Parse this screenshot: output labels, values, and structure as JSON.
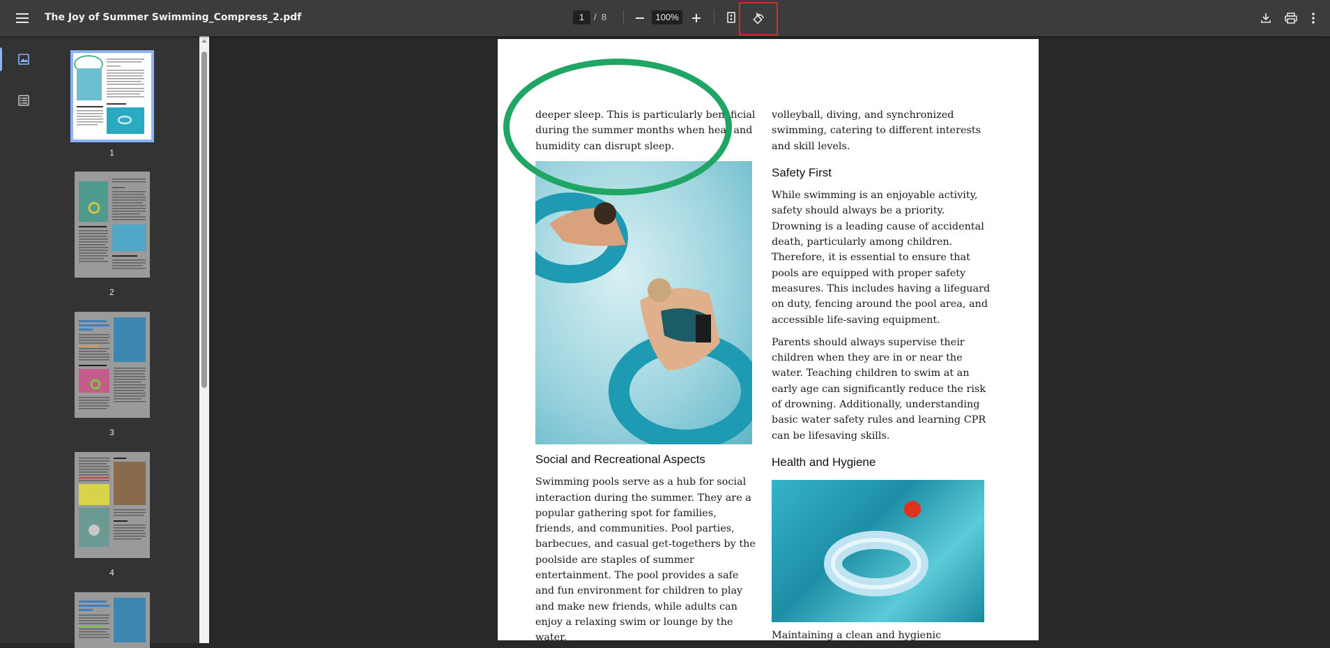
{
  "toolbar": {
    "title": "The Joy of Summer Swimming_Compress_2.pdf",
    "current_page": "1",
    "page_separator": "/",
    "total_pages": "8",
    "zoom": "100%"
  },
  "sidebar": {
    "thumbnails": [
      {
        "label": "1"
      },
      {
        "label": "2"
      },
      {
        "label": "3"
      },
      {
        "label": "4"
      }
    ]
  },
  "document": {
    "left_col": {
      "intro": "deeper sleep. This is particularly beneficial during the summer months when heat and humidity can disrupt sleep.",
      "heading": "Social and Recreational Aspects",
      "para": "Swimming pools serve as a hub for social interaction during the summer. They are a popular gathering spot for families, friends, and communities. Pool parties, barbecues, and casual get-togethers by the poolside are staples of summer entertainment. The pool provides a safe and fun environment for children to play and make new friends, while adults can enjoy a relaxing swim or lounge by the water."
    },
    "right_col": {
      "intro": "volleyball, diving, and synchronized swimming, catering to different interests and skill levels.",
      "heading1": "Safety First",
      "para1": "While swimming is an enjoyable activity, safety should always be a priority. Drowning is a leading cause of accidental death, particularly among children. Therefore, it is essential to ensure that pools are equipped with proper safety measures. This includes having a lifeguard on duty, fencing around the pool area, and accessible life-saving equipment.",
      "para2": "Parents should always supervise their children when they are in or near the water. Teaching children to swim at an early age can significantly reduce the risk of drowning. Additionally, understanding basic water safety rules and learning CPR can be lifesaving skills.",
      "heading2": "Health and Hygiene",
      "para3": "Maintaining a clean and hygienic swimming"
    }
  },
  "colors": {
    "toolbar_bg": "#3c3c3c",
    "sidebar_bg": "#333333",
    "viewer_bg": "#282828",
    "annotation_circle": "#21a565",
    "highlight_box": "#d9262b"
  }
}
